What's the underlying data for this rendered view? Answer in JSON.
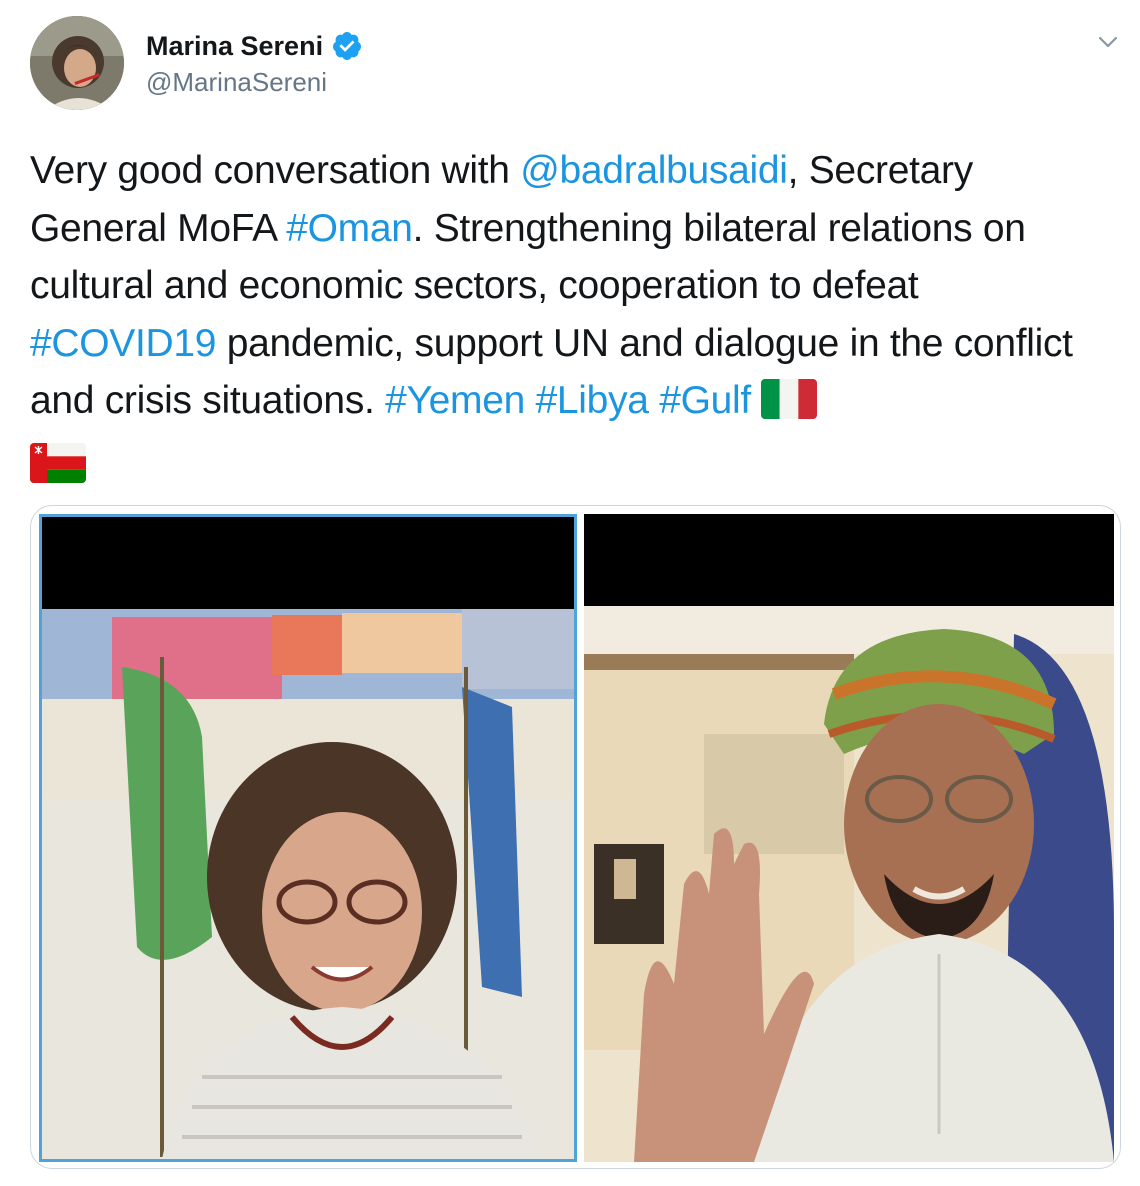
{
  "author": {
    "name": "Marina Sereni",
    "handle": "@MarinaSereni",
    "verified": true,
    "avatar_icon": "profile-photo"
  },
  "tweet": {
    "segments": [
      {
        "text": "Very good conversation with ",
        "type": "text"
      },
      {
        "text": "@badralbusaidi",
        "type": "mention"
      },
      {
        "text": ", Secretary General MoFA ",
        "type": "text"
      },
      {
        "text": "#Oman",
        "type": "hashtag"
      },
      {
        "text": ". Strengthening bilateral relations on cultural and economic sectors, cooperation to defeat ",
        "type": "text"
      },
      {
        "text": "#COVID19",
        "type": "hashtag"
      },
      {
        "text": " pandemic, support UN and dialogue in the conflict and crisis situations. ",
        "type": "text"
      },
      {
        "text": "#Yemen",
        "type": "hashtag"
      },
      {
        "text": " ",
        "type": "text"
      },
      {
        "text": "#Libya",
        "type": "hashtag"
      },
      {
        "text": " ",
        "type": "text"
      },
      {
        "text": "#Gulf",
        "type": "hashtag"
      }
    ],
    "emoji": [
      "flag-italy-icon",
      "flag-oman-icon"
    ]
  },
  "colors": {
    "link": "#1b95e0",
    "text": "#14171a",
    "secondary": "#657786",
    "verified": "#1da1f2"
  },
  "media": {
    "panels": [
      "video-call-woman",
      "video-call-man-in-turban"
    ]
  }
}
